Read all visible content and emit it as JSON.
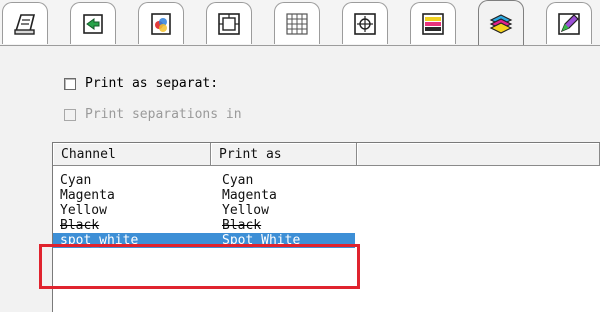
{
  "tabs": [
    {
      "icon": "printer-page-icon",
      "active": false
    },
    {
      "icon": "arrow-page-icon",
      "active": false
    },
    {
      "icon": "color-page-icon",
      "active": false
    },
    {
      "icon": "frame-icon",
      "active": false
    },
    {
      "icon": "grid-icon",
      "active": false
    },
    {
      "icon": "crosshair-icon",
      "active": false
    },
    {
      "icon": "color-bars-icon",
      "active": false
    },
    {
      "icon": "ink-layers-icon",
      "active": true
    },
    {
      "icon": "pen-color-icon",
      "active": false
    }
  ],
  "options": {
    "print_separations_label": "Print as separat:",
    "print_separations_in_label": "Print separations in"
  },
  "table": {
    "headers": [
      "Channel",
      "Print as",
      ""
    ],
    "rows": [
      {
        "channel": "Cyan",
        "print_as": "Cyan"
      },
      {
        "channel": "Magenta",
        "print_as": "Magenta"
      },
      {
        "channel": "Yellow",
        "print_as": "Yellow"
      },
      {
        "channel": "Black",
        "print_as": "Black"
      },
      {
        "channel": "spot_white",
        "print_as": "Spot_White"
      }
    ],
    "selected_row": 4
  },
  "colors": {
    "selection": "#3d8fd6",
    "highlight_border": "#e0232e"
  }
}
